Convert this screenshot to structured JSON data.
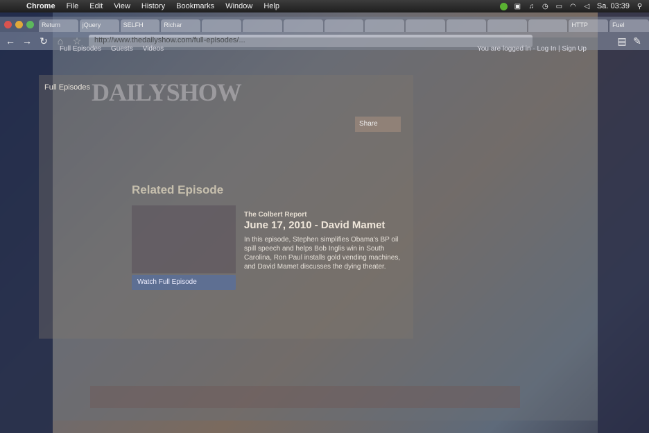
{
  "menubar": {
    "app_name": "Chrome",
    "items": [
      "File",
      "Edit",
      "View",
      "History",
      "Bookmarks",
      "Window",
      "Help"
    ],
    "clock": "Sa. 03:39"
  },
  "browser": {
    "tabs": [
      "Return",
      "jQuery",
      "SELFH",
      "Richar",
      "",
      "",
      "",
      "",
      "",
      "",
      "",
      "",
      "",
      "HTTP",
      "Fuel"
    ],
    "url": "http://www.thedailyshow.com/full-episodes/..."
  },
  "page": {
    "site_header": [
      "Full Episodes",
      "Guests",
      "Videos"
    ],
    "login_text": "You are logged in · Log In | Sign Up",
    "logo_text": "DAILYSHOW",
    "breadcrumb": "Full Episodes",
    "related_title": "Related Episode",
    "episode": {
      "show": "The Colbert Report",
      "title": "June 17, 2010 - David Mamet",
      "description": "In this episode, Stephen simplifies Obama's BP oil spill speech and helps Bob Inglis win in South Carolina, Ron Paul installs gold vending machines, and David Mamet discusses the dying theater."
    },
    "watch_label": "Watch Full Episode",
    "sidebar_label": "Share"
  }
}
